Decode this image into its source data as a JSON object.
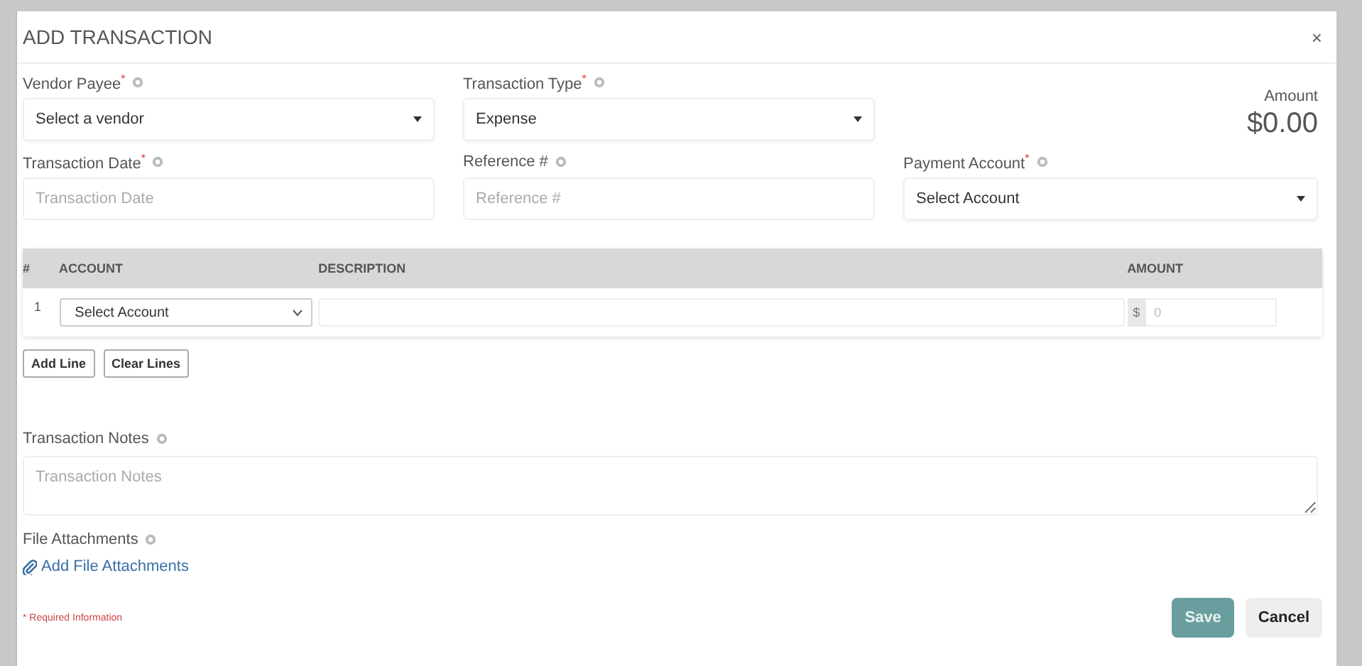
{
  "dialog": {
    "title": "ADD TRANSACTION",
    "close": "×"
  },
  "fields": [
    {
      "kind": "select",
      "label": "Vendor Payee$^{*}$",
      "value": "Select a vendor"
    },
    {
      "kind": "select",
      "label": "Transaction Type$^{*}$",
      "value": "Expense"
    },
    {
      "kind": "input",
      "label": "Transaction Date$^{*}$",
      "placeholder": "Transaction Date"
    },
    {
      "kind": "input",
      "label": "Reference #",
      "placeholder": "Reference #"
    },
    {
      "kind": "select",
      "label": "Payment Account$^{*}$",
      "value": "Select Account"
    }
  ],
  "amount": {
    "label": "Amount",
    "value": "$0.00"
  },
  "table": {
    "columns": [
      "#",
      "ACCOUNT",
      "DESCRIPTION",
      "AMOUNT"
    ],
    "rows": [
      {
        "number": "1",
        "account": "Select Account",
        "currency": "$",
        "amount_placeholder": "0"
      }
    ]
  },
  "line_buttons": [
    "Add Line",
    "Clear Lines"
  ],
  "notes": {
    "label": "Transaction Notes",
    "placeholder": "Transaction Notes"
  },
  "attachments": {
    "label": "File Attachments",
    "link": "Add File Attachments"
  },
  "required_note": "* Required Information",
  "buttons": [
    {
      "label": "Save",
      "kind": "primary"
    },
    {
      "label": "Cancel",
      "kind": "secondary"
    }
  ]
}
